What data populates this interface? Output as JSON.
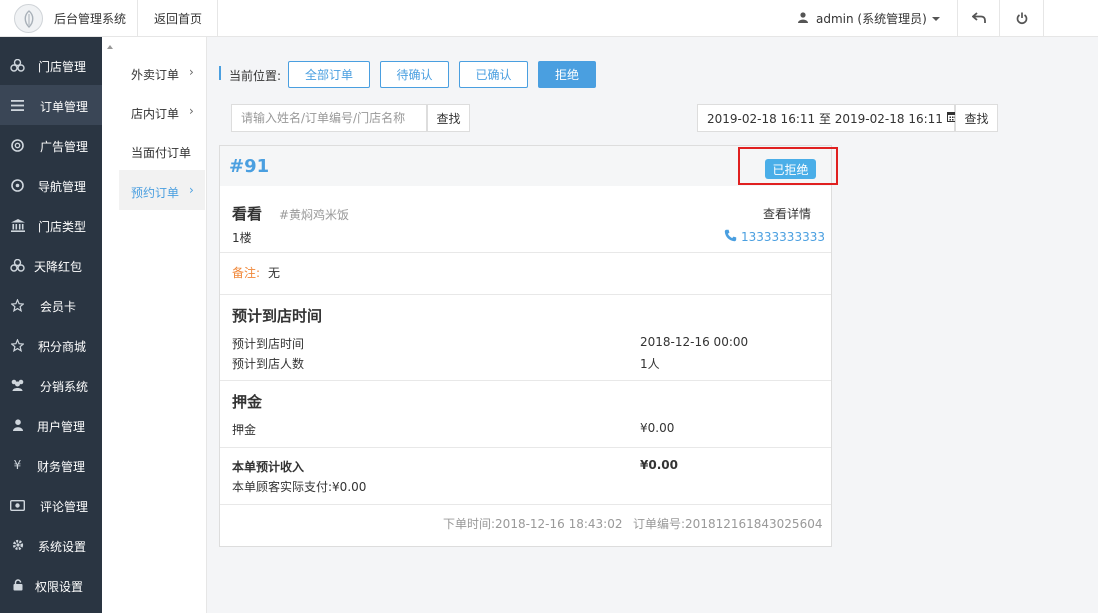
{
  "topbar": {
    "app_title": "后台管理系统",
    "back_home": "返回首页",
    "user": "admin (系统管理员)"
  },
  "sidebar": {
    "items": [
      {
        "label": "门店管理",
        "icon": "stores-icon"
      },
      {
        "label": "订单管理",
        "icon": "menu-lines-icon"
      },
      {
        "label": "广告管理",
        "icon": "lifebuoy-icon"
      },
      {
        "label": "导航管理",
        "icon": "compass-icon"
      },
      {
        "label": "门店类型",
        "icon": "bank-icon"
      },
      {
        "label": "天降红包",
        "icon": "stores-icon"
      },
      {
        "label": "会员卡",
        "icon": "star-icon"
      },
      {
        "label": "积分商城",
        "icon": "star-icon"
      },
      {
        "label": "分销系统",
        "icon": "users-icon"
      },
      {
        "label": "用户管理",
        "icon": "user-icon"
      },
      {
        "label": "财务管理",
        "icon": "yen-icon"
      },
      {
        "label": "评论管理",
        "icon": "comment-icon"
      },
      {
        "label": "系统设置",
        "icon": "gear-icon"
      },
      {
        "label": "权限设置",
        "icon": "lock-icon"
      }
    ]
  },
  "subnav": {
    "items": [
      {
        "label": "外卖订单",
        "arrow": "›"
      },
      {
        "label": "店内订单",
        "arrow": "›"
      },
      {
        "label": "当面付订单",
        "arrow": ""
      },
      {
        "label": "预约订单",
        "arrow": "›"
      }
    ]
  },
  "main": {
    "crumb_label": "当前位置:",
    "filters": [
      "全部订单",
      "待确认",
      "已确认",
      "拒绝"
    ],
    "search_placeholder": "请输入姓名/订单编号/门店名称",
    "search_btn": "查找",
    "date_range": "2019-02-18 16:11 至 2019-02-18 16:11",
    "date_search_btn": "查找"
  },
  "order": {
    "number": "#91",
    "status": "已拒绝",
    "customer_name": "看看",
    "store_tag": "#黄焖鸡米饭",
    "view_detail": "查看详情",
    "floor": "1楼",
    "phone": "13333333333",
    "note_label": "备注:",
    "note_value": "无",
    "arrival_section_title": "预计到店时间",
    "arrival_time_label": "预计到店时间",
    "arrival_time_value": "2018-12-16 00:00",
    "arrival_people_label": "预计到店人数",
    "arrival_people_value": "1人",
    "deposit_section_title": "押金",
    "deposit_label": "押金",
    "deposit_value": "¥0.00",
    "income_label": "本单预计收入",
    "income_value": "¥0.00",
    "paid_label": "本单顾客实际支付:¥0.00",
    "placed_time": "下单时间:2018-12-16 18:43:02",
    "order_code": "订单编号:201812161843025604"
  },
  "colors": {
    "accent": "#4a9fe0",
    "sidebar_bg": "#2a3542",
    "highlight": "#e02020",
    "note_label": "#f0883a"
  }
}
